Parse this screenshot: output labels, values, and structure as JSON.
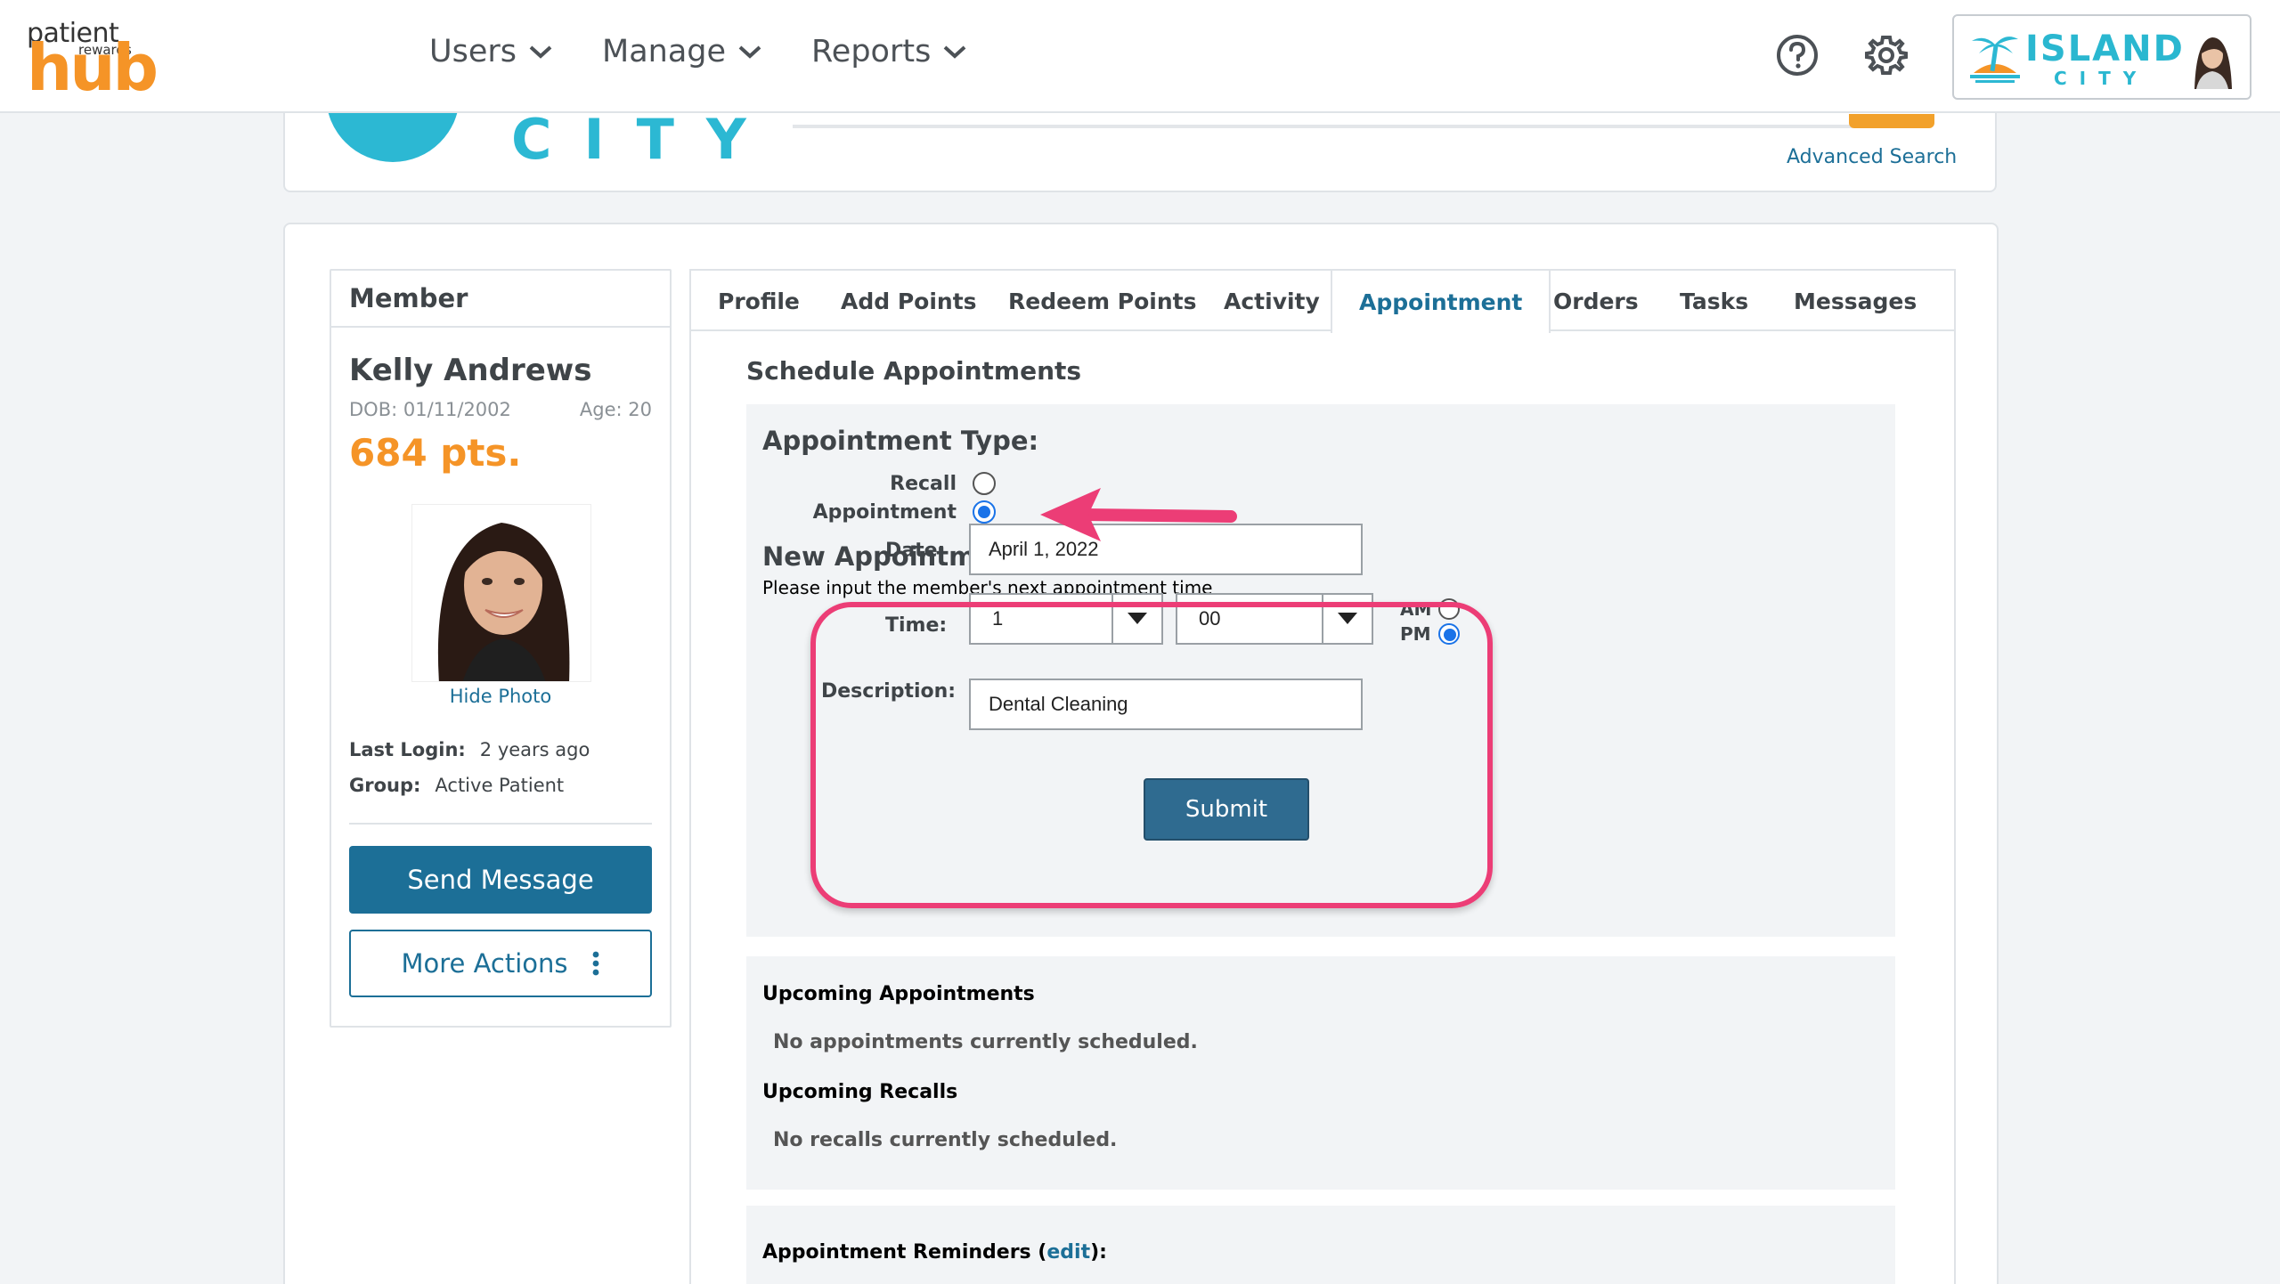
{
  "nav": {
    "logo": {
      "line1": "patient",
      "line2": "rewards",
      "line3": "hub"
    },
    "menu": [
      {
        "label": "Users"
      },
      {
        "label": "Manage"
      },
      {
        "label": "Reports"
      }
    ],
    "brand": {
      "word1": "ISLAND",
      "word2": "CITY"
    }
  },
  "header": {
    "city_text": "CITY",
    "advanced_search": "Advanced Search"
  },
  "member": {
    "heading": "Member",
    "name": "Kelly Andrews",
    "dob": "DOB: 01/11/2002",
    "age": "Age:  20",
    "points": "684 pts.",
    "hide_photo": "Hide Photo",
    "last_login_label": "Last Login:",
    "last_login_value": "2 years ago",
    "group_label": "Group:",
    "group_value": "Active Patient",
    "send_message": "Send Message",
    "more_actions": "More Actions"
  },
  "tabs": [
    {
      "label": "Profile"
    },
    {
      "label": "Add Points"
    },
    {
      "label": "Redeem Points"
    },
    {
      "label": "Activity"
    },
    {
      "label": "Appointment",
      "active": true
    },
    {
      "label": "Orders"
    },
    {
      "label": "Tasks"
    },
    {
      "label": "Messages"
    }
  ],
  "schedule": {
    "title": "Schedule Appointments",
    "type_heading": "Appointment Type:",
    "recall_label": "Recall",
    "appointment_label": "Appointment",
    "selected_type": "Appointment",
    "new_heading": "New Appointment:",
    "new_sub": "Please input the member's next appointment time",
    "date_label": "Date:",
    "date_value": "April 1, 2022",
    "time_label": "Time:",
    "hour_value": "1",
    "minute_value": "00",
    "am_label": "AM",
    "pm_label": "PM",
    "selected_period": "PM",
    "desc_label": "Description:",
    "desc_value": "Dental Cleaning",
    "submit": "Submit"
  },
  "upcoming": {
    "appointments_heading": "Upcoming Appointments",
    "appointments_text": "No appointments currently scheduled.",
    "recalls_heading": "Upcoming Recalls",
    "recalls_text": "No recalls currently scheduled."
  },
  "reminders": {
    "heading_prefix": "Appointment Reminders (",
    "edit_link": "edit",
    "heading_suffix": "):"
  },
  "colors": {
    "primary": "#1c6f97",
    "accent_orange": "#f59427",
    "brand_cyan": "#2cb8d3",
    "annotation_pink": "#ec3d76"
  }
}
